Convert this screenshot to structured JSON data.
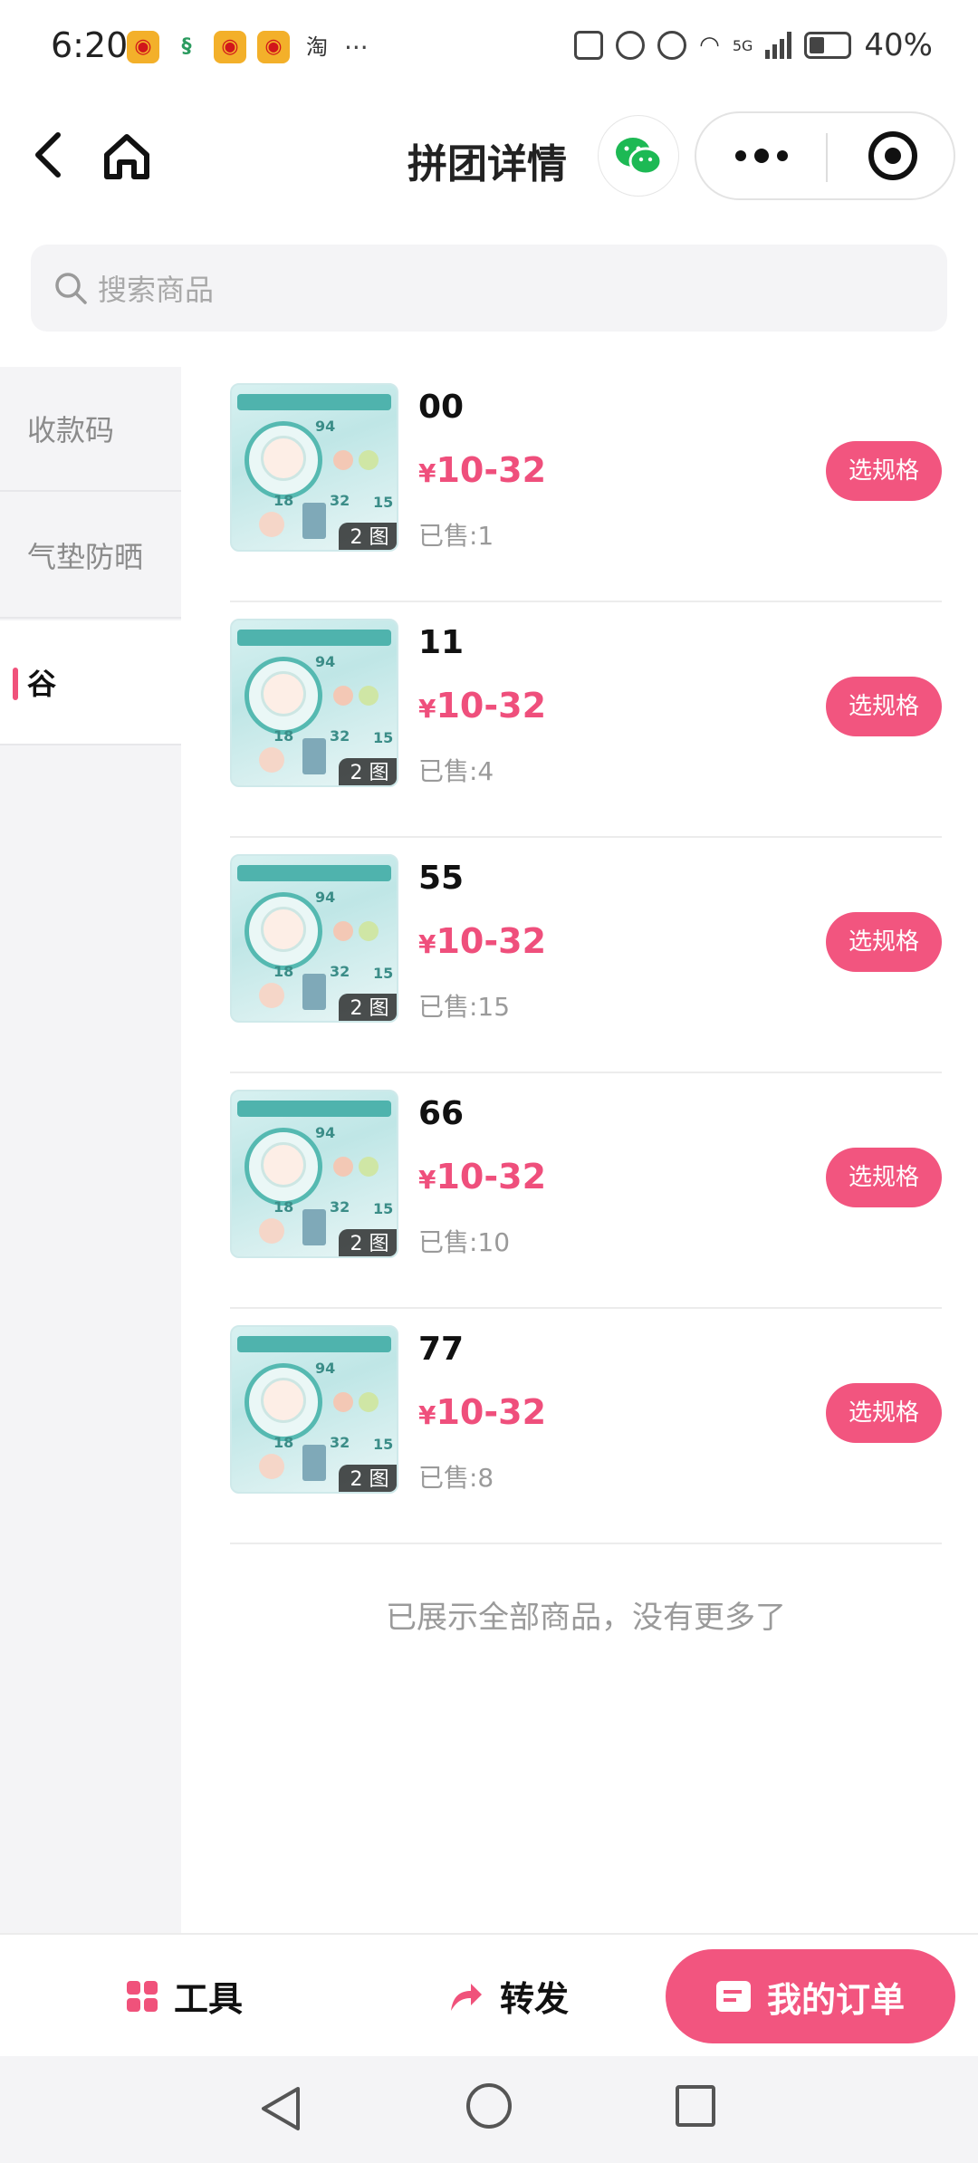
{
  "status_bar": {
    "time": "6:20",
    "app_glyph": "淘",
    "more": "···",
    "battery": "40%",
    "network": "5G"
  },
  "header": {
    "title": "拼团详情"
  },
  "search": {
    "placeholder": "搜索商品"
  },
  "sidebar": {
    "categories": [
      {
        "label": "收款码",
        "active": false
      },
      {
        "label": "气垫防晒",
        "active": false
      },
      {
        "label": "谷",
        "active": true
      }
    ]
  },
  "products": [
    {
      "name": "00",
      "currency": "¥",
      "price": "10-32",
      "sold": "已售:1",
      "img_count": "2 图",
      "action": "选规格"
    },
    {
      "name": "11",
      "currency": "¥",
      "price": "10-32",
      "sold": "已售:4",
      "img_count": "2 图",
      "action": "选规格"
    },
    {
      "name": "55",
      "currency": "¥",
      "price": "10-32",
      "sold": "已售:15",
      "img_count": "2 图",
      "action": "选规格"
    },
    {
      "name": "66",
      "currency": "¥",
      "price": "10-32",
      "sold": "已售:10",
      "img_count": "2 图",
      "action": "选规格"
    },
    {
      "name": "77",
      "currency": "¥",
      "price": "10-32",
      "sold": "已售:8",
      "img_count": "2 图",
      "action": "选规格"
    }
  ],
  "thumb_text": {
    "a": "94",
    "b": "18",
    "c": "32",
    "d": "15"
  },
  "end_note": "已展示全部商品，没有更多了",
  "bottom_bar": {
    "tools": "工具",
    "share": "转发",
    "orders": "我的订单"
  },
  "colors": {
    "accent": "#f2557f",
    "price": "#ef4f7c",
    "sidebar_bg": "#f4f4f6"
  }
}
